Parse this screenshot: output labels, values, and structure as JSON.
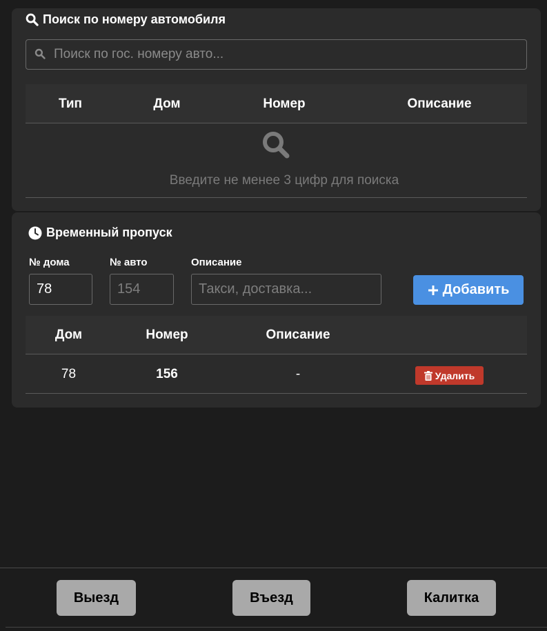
{
  "search_section": {
    "title": "Поиск по номеру автомобиля",
    "placeholder": "Поиск по гос. номеру авто...",
    "columns": [
      "Тип",
      "Дом",
      "Номер",
      "Описание"
    ],
    "empty_message": "Введите не менее 3 цифр для поиска"
  },
  "temp_pass": {
    "title": "Временный пропуск",
    "form": {
      "house_label": "№ дома",
      "house_value": "78",
      "car_label": "№ авто",
      "car_placeholder": "154",
      "desc_label": "Описание",
      "desc_placeholder": "Такси, доставка...",
      "add_label": "Добавить"
    },
    "columns": [
      "Дом",
      "Номер",
      "Описание"
    ],
    "rows": [
      {
        "house": "78",
        "number": "156",
        "description": "-",
        "delete_label": "Удалить"
      }
    ]
  },
  "footer": {
    "exit_label": "Выезд",
    "entry_label": "Въезд",
    "gate_label": "Калитка"
  },
  "colors": {
    "background": "#1c1c1c",
    "card": "#2b2b2b",
    "accent_blue": "#4a90e2",
    "danger_red": "#c0392b",
    "footer_button": "#a9a9a9"
  },
  "icons": {
    "search_title": "search-icon",
    "search_input": "search-icon",
    "empty_state": "search-icon",
    "pass_title": "clock-icon",
    "add": "plus-icon",
    "delete": "trash-icon"
  }
}
